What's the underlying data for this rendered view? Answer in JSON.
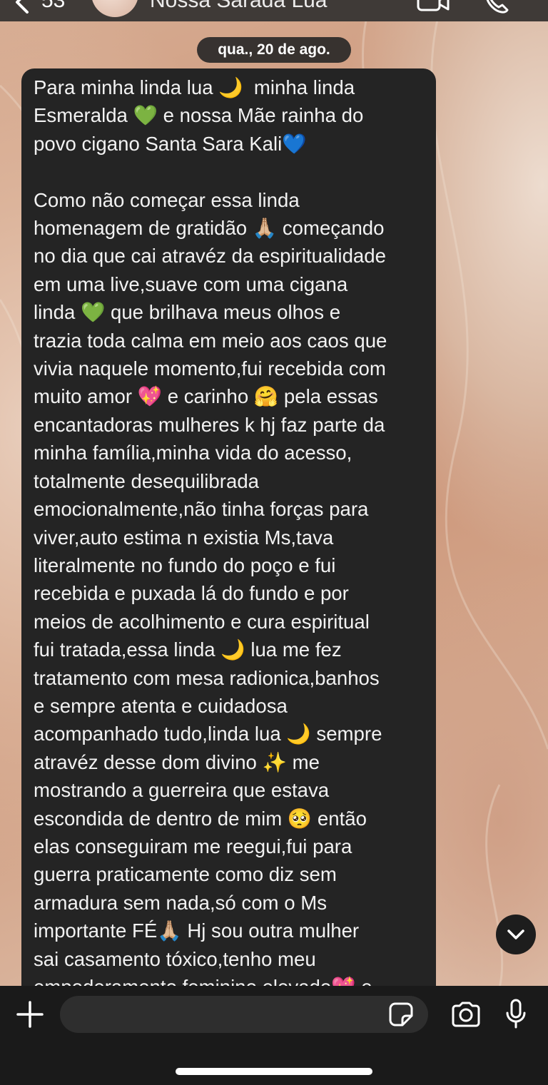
{
  "header": {
    "back_count": "53",
    "contact_name": "Nossa Sarada Lua"
  },
  "conversation": {
    "date_label": "qua., 20 de ago.",
    "message_text": "Para minha linda lua 🌙  minha linda\nEsmeralda 💚 e nossa Mãe rainha do\npovo cigano Santa Sara Kali💙\n\nComo não começar essa linda\nhomenagem de gratidão 🙏🏼 começando\nno dia que cai atravéz da espiritualidade\nem uma live,suave com uma cigana\nlinda 💚 que brilhava meus olhos e\ntrazia toda calma em meio aos caos que\nvivia naquele momento,fui recebida com\nmuito amor 💖 e carinho 🤗 pela essas\nencantadoras mulheres k hj faz parte da\nminha família,minha vida do acesso,\ntotalmente desequilibrada\nemocionalmente,não tinha forças para\nviver,auto estima n existia Ms,tava\nliteralmente no fundo do poço e fui\nrecebida e puxada lá do fundo e por\nmeios de acolhimento e cura espiritual\nfui tratada,essa linda 🌙 lua me fez\ntratamento com mesa radionica,banhos\ne sempre atenta e cuidadosa\nacompanhado tudo,linda lua 🌙 sempre\natravéz desse dom divino ✨ me\nmostrando a guerreira que estava\nescondida de dentro de mim 🥺 então\nelas conseguiram me reegui,fui para\nguerra praticamente como diz sem\narmadura sem nada,só com o Ms\nimportante FÉ🙏🏼 Hj sou outra mulher\nsai casamento tóxico,tenho meu\nempoderamento feminino elevado💖 e"
  },
  "composer": {
    "input_value": "",
    "input_placeholder": ""
  },
  "icons": {
    "back": "chevron-left-icon",
    "video_call": "video-camera-icon",
    "voice_call": "phone-icon",
    "scroll_down": "chevron-down-icon",
    "attach": "plus-icon",
    "sticker": "sticker-icon",
    "camera": "camera-icon",
    "microphone": "microphone-icon"
  },
  "colors": {
    "bubble_background": "#242424",
    "bubble_text": "#f2f2f2",
    "composer_background": "#1a1a1a",
    "date_chip_background": "#262626"
  }
}
